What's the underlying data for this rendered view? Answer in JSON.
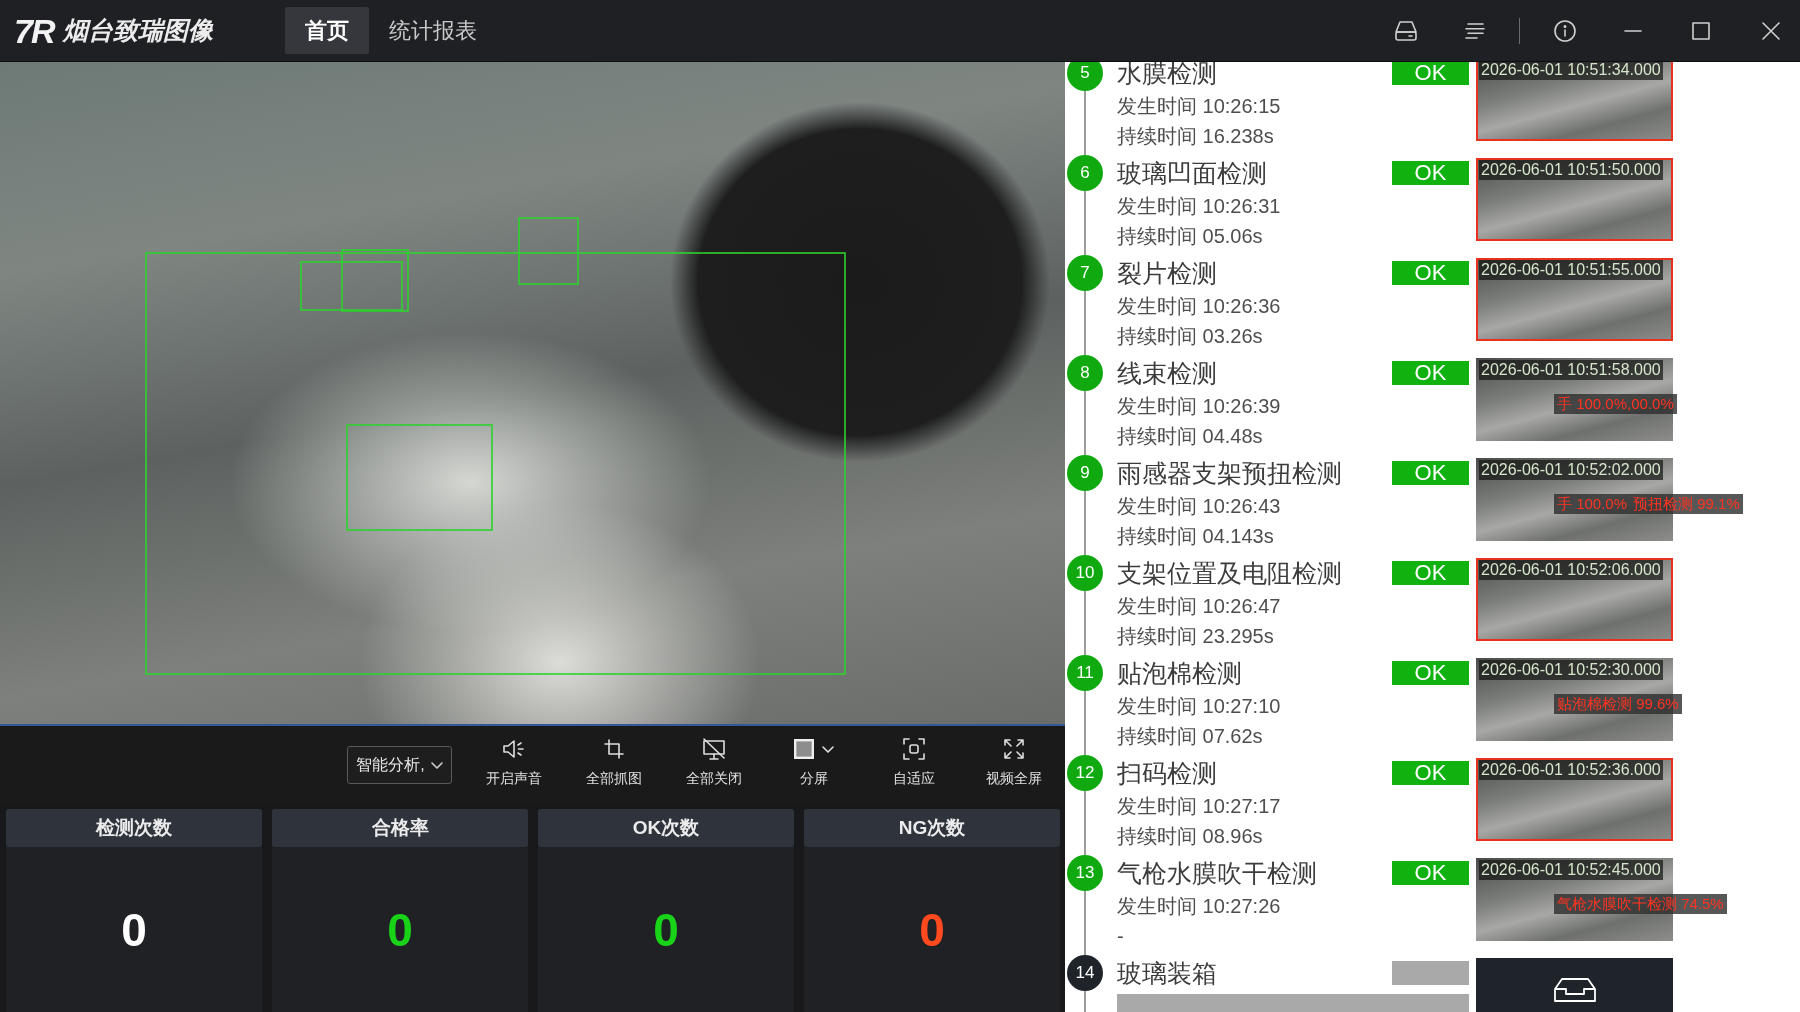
{
  "app": {
    "logo_mark": "7R",
    "name": "烟台致瑞图像"
  },
  "tabs": [
    {
      "label": "首页",
      "selected": true
    },
    {
      "label": "统计报表",
      "selected": false
    }
  ],
  "toolbar": {
    "mode_select": {
      "value": "智能分析,"
    },
    "tools": [
      {
        "label": "开启声音",
        "kind": "sound"
      },
      {
        "label": "全部抓图",
        "kind": "capture"
      },
      {
        "label": "全部关闭",
        "kind": "close-all"
      },
      {
        "label": "分屏",
        "kind": "split"
      },
      {
        "label": "自适应",
        "kind": "fit"
      },
      {
        "label": "视频全屏",
        "kind": "fullscreen"
      }
    ]
  },
  "stats": [
    {
      "label": "检测次数",
      "value": "0",
      "color": "#ffffff"
    },
    {
      "label": "合格率",
      "value": "0",
      "color": "#19d319"
    },
    {
      "label": "OK次数",
      "value": "0",
      "color": "#19d319"
    },
    {
      "label": "NG次数",
      "value": "0",
      "color": "#ff4a1f"
    }
  ],
  "steps": [
    {
      "number": "5",
      "title": "水膜检测",
      "occurred": "发生时间 10:26:15",
      "duration": "持续时间 16.238s",
      "completed": true,
      "result": "OK",
      "snapshot": {
        "time": "2026-06-01 10:51:34.000",
        "flagged": true
      }
    },
    {
      "number": "6",
      "title": "玻璃凹面检测",
      "occurred": "发生时间 10:26:31",
      "duration": "持续时间 05.06s",
      "completed": true,
      "result": "OK",
      "snapshot": {
        "time": "2026-06-01 10:51:50.000",
        "flagged": true
      }
    },
    {
      "number": "7",
      "title": "裂片检测",
      "occurred": "发生时间 10:26:36",
      "duration": "持续时间 03.26s",
      "completed": true,
      "result": "OK",
      "snapshot": {
        "time": "2026-06-01 10:51:55.000",
        "flagged": true
      }
    },
    {
      "number": "8",
      "title": "线束检测",
      "occurred": "发生时间 10:26:39",
      "duration": "持续时间 04.48s",
      "completed": true,
      "result": "OK",
      "snapshot": {
        "time": "2026-06-01 10:51:58.000",
        "flagged": false,
        "labels": [
          "手 100.0%,00.0%"
        ]
      }
    },
    {
      "number": "9",
      "title": "雨感器支架预扭检测",
      "occurred": "发生时间 10:26:43",
      "duration": "持续时间 04.143s",
      "completed": true,
      "result": "OK",
      "snapshot": {
        "time": "2026-06-01 10:52:02.000",
        "flagged": false,
        "labels": [
          "手 100.0%",
          "预扭检测 99.1%"
        ]
      }
    },
    {
      "number": "10",
      "title": "支架位置及电阻检测",
      "occurred": "发生时间 10:26:47",
      "duration": "持续时间 23.295s",
      "completed": true,
      "result": "OK",
      "snapshot": {
        "time": "2026-06-01 10:52:06.000",
        "flagged": true
      }
    },
    {
      "number": "11",
      "title": "贴泡棉检测",
      "occurred": "发生时间 10:27:10",
      "duration": "持续时间 07.62s",
      "completed": true,
      "result": "OK",
      "snapshot": {
        "time": "2026-06-01 10:52:30.000",
        "flagged": false,
        "labels": [
          "贴泡棉检测 99.6%"
        ]
      }
    },
    {
      "number": "12",
      "title": "扫码检测",
      "occurred": "发生时间 10:27:17",
      "duration": "持续时间 08.96s",
      "completed": true,
      "result": "OK",
      "snapshot": {
        "time": "2026-06-01 10:52:36.000",
        "flagged": true
      }
    },
    {
      "number": "13",
      "title": "气枪水膜吹干检测",
      "occurred": "发生时间 10:27:26",
      "duration": "-",
      "completed": true,
      "result": "OK",
      "snapshot": {
        "time": "2026-06-01 10:52:45.000",
        "flagged": false,
        "labels": [
          "气枪水膜吹干检测 74.5%"
        ]
      }
    },
    {
      "number": "14",
      "title": "玻璃装箱",
      "completed": false
    }
  ]
}
